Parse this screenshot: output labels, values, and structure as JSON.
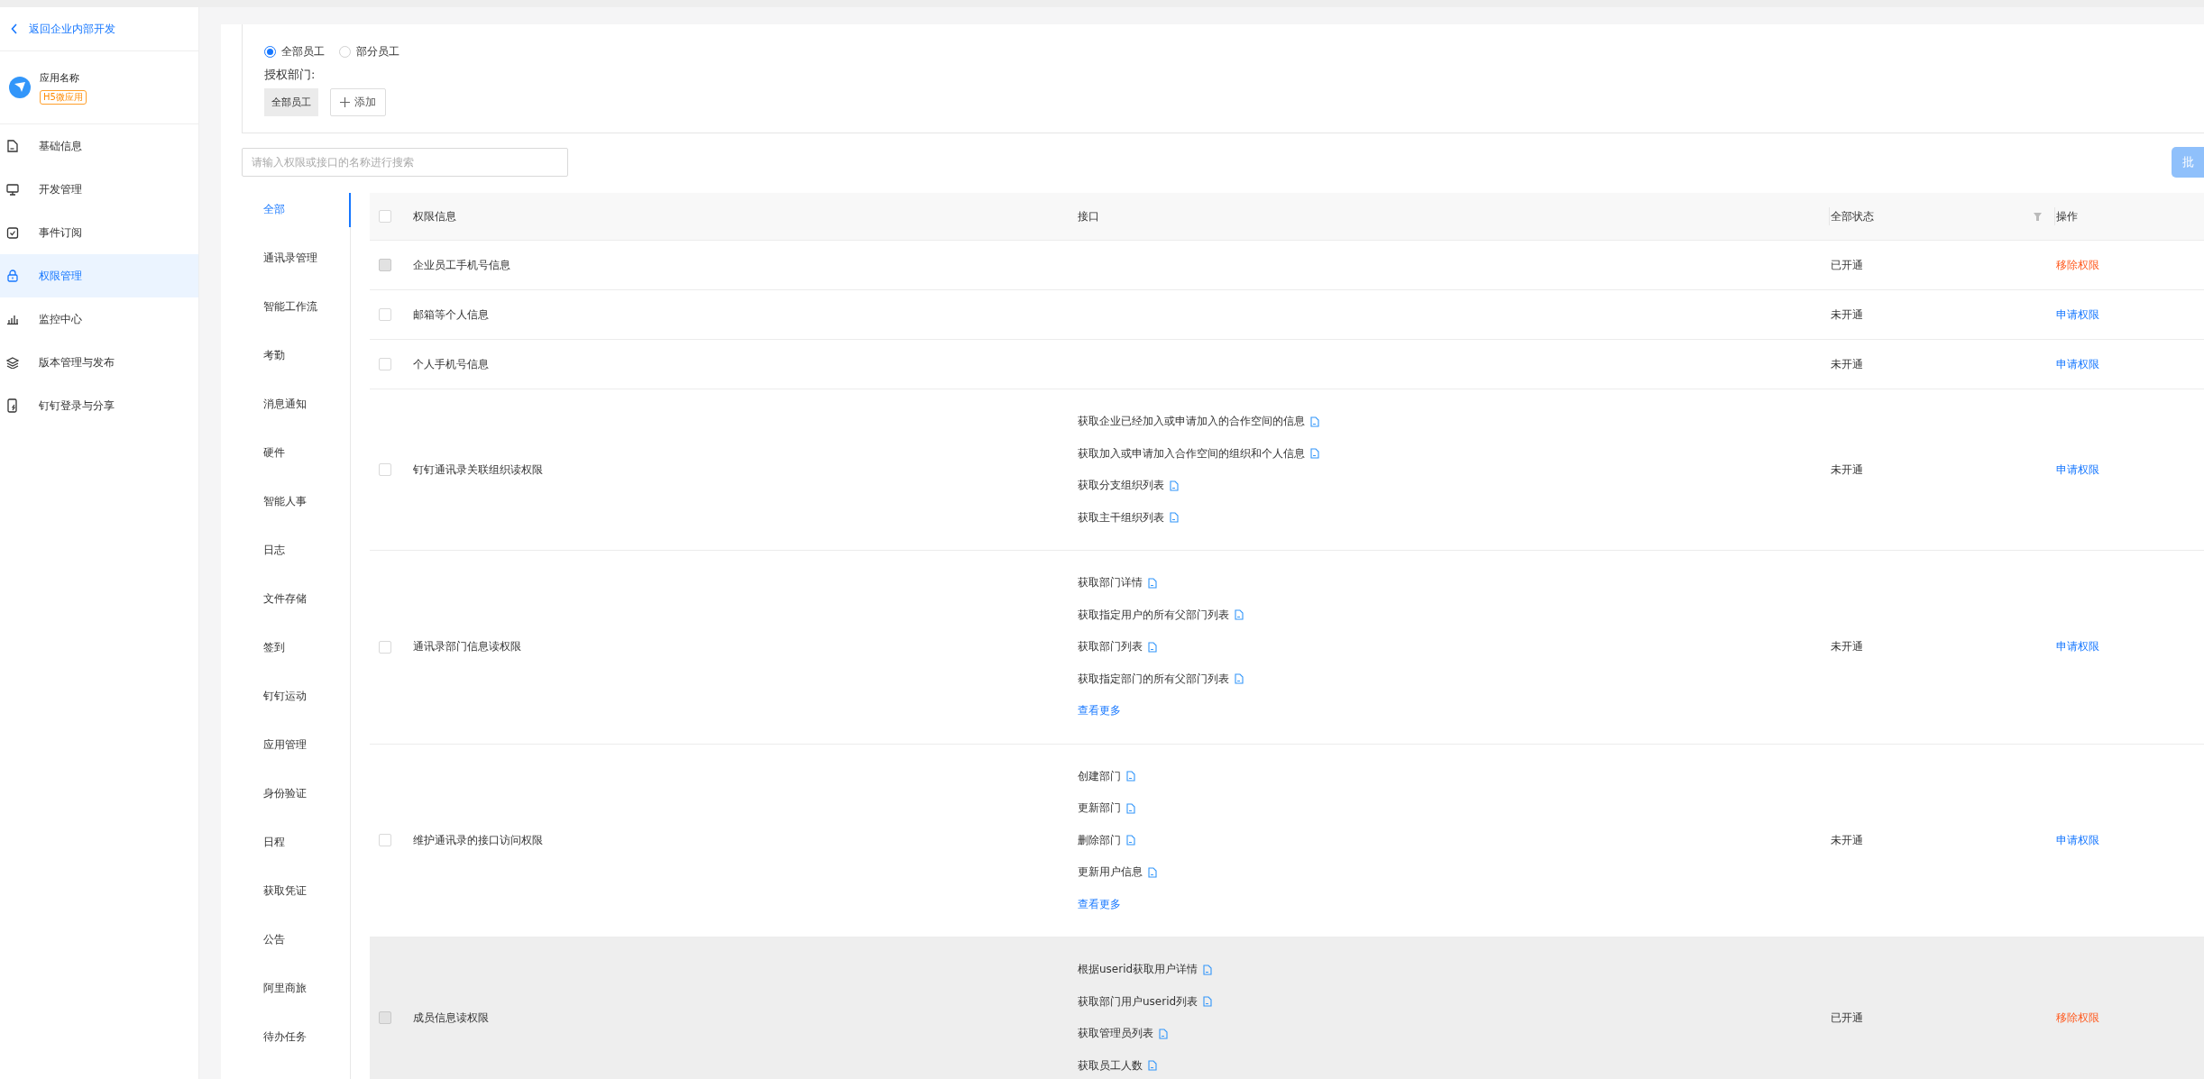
{
  "sidebar": {
    "back_link": "返回企业内部开发",
    "app": {
      "name": "应用名称",
      "badge": "H5微应用"
    },
    "menu": [
      {
        "label": "基础信息",
        "kind": "document",
        "selected": false
      },
      {
        "label": "开发管理",
        "kind": "monitor",
        "selected": false
      },
      {
        "label": "事件订阅",
        "kind": "check",
        "selected": false
      },
      {
        "label": "权限管理",
        "kind": "lock",
        "selected": true
      },
      {
        "label": "监控中心",
        "kind": "chart",
        "selected": false
      },
      {
        "label": "版本管理与发布",
        "kind": "layers",
        "selected": false
      },
      {
        "label": "钉钉登录与分享",
        "kind": "phone",
        "selected": false
      }
    ]
  },
  "scope": {
    "radios": [
      {
        "label": "全部员工",
        "selected": true
      },
      {
        "label": "部分员工",
        "selected": false
      }
    ],
    "dept_label": "授权部门:",
    "dept_tags": [
      "全部员工"
    ],
    "add_button": "添加"
  },
  "search": {
    "placeholder": "请输入权限或接口的名称进行搜索"
  },
  "batch_button": "批",
  "categories": [
    {
      "label": "全部",
      "selected": true
    },
    {
      "label": "通讯录管理",
      "selected": false
    },
    {
      "label": "智能工作流",
      "selected": false
    },
    {
      "label": "考勤",
      "selected": false
    },
    {
      "label": "消息通知",
      "selected": false
    },
    {
      "label": "硬件",
      "selected": false
    },
    {
      "label": "智能人事",
      "selected": false
    },
    {
      "label": "日志",
      "selected": false
    },
    {
      "label": "文件存储",
      "selected": false
    },
    {
      "label": "签到",
      "selected": false
    },
    {
      "label": "钉钉运动",
      "selected": false
    },
    {
      "label": "应用管理",
      "selected": false
    },
    {
      "label": "身份验证",
      "selected": false
    },
    {
      "label": "日程",
      "selected": false
    },
    {
      "label": "获取凭证",
      "selected": false
    },
    {
      "label": "公告",
      "selected": false
    },
    {
      "label": "阿里商旅",
      "selected": false
    },
    {
      "label": "待办任务",
      "selected": false
    }
  ],
  "table": {
    "header_checked": false,
    "columns": [
      {
        "label": "权限信息",
        "filter": false
      },
      {
        "label": "接口",
        "filter": false
      },
      {
        "label": "全部状态",
        "filter": true
      },
      {
        "label": "操作",
        "filter": false
      }
    ],
    "rows": [
      {
        "name": "企业员工手机号信息",
        "apis": [],
        "status": "已开通",
        "action": "移除权限",
        "kind": "remove",
        "checkbox_disabled": true,
        "highlighted": false
      },
      {
        "name": "邮箱等个人信息",
        "apis": [],
        "status": "未开通",
        "action": "申请权限",
        "kind": "apply",
        "checkbox_disabled": false,
        "highlighted": false
      },
      {
        "name": "个人手机号信息",
        "apis": [],
        "status": "未开通",
        "action": "申请权限",
        "kind": "apply",
        "checkbox_disabled": false,
        "highlighted": false
      },
      {
        "name": "钉钉通讯录关联组织读权限",
        "apis": [
          "获取企业已经加入或申请加入的合作空间的信息",
          "获取加入或申请加入合作空间的组织和个人信息",
          "获取分支组织列表",
          "获取主干组织列表"
        ],
        "status": "未开通",
        "action": "申请权限",
        "kind": "apply",
        "checkbox_disabled": false,
        "highlighted": false
      },
      {
        "name": "通讯录部门信息读权限",
        "apis": [
          "获取部门详情",
          "获取指定用户的所有父部门列表",
          "获取部门列表",
          "获取指定部门的所有父部门列表"
        ],
        "more_link": "查看更多",
        "status": "未开通",
        "action": "申请权限",
        "kind": "apply",
        "checkbox_disabled": false,
        "highlighted": false
      },
      {
        "name": "维护通讯录的接口访问权限",
        "apis": [
          "创建部门",
          "更新部门",
          "删除部门",
          "更新用户信息"
        ],
        "more_link": "查看更多",
        "status": "未开通",
        "action": "申请权限",
        "kind": "apply",
        "checkbox_disabled": false,
        "highlighted": false
      },
      {
        "name": "成员信息读权限",
        "apis": [
          "根据userid获取用户详情",
          "获取部门用户userid列表",
          "获取管理员列表",
          "获取员工人数"
        ],
        "status": "已开通",
        "action": "移除权限",
        "kind": "remove",
        "checkbox_disabled": true,
        "highlighted": true
      }
    ]
  }
}
